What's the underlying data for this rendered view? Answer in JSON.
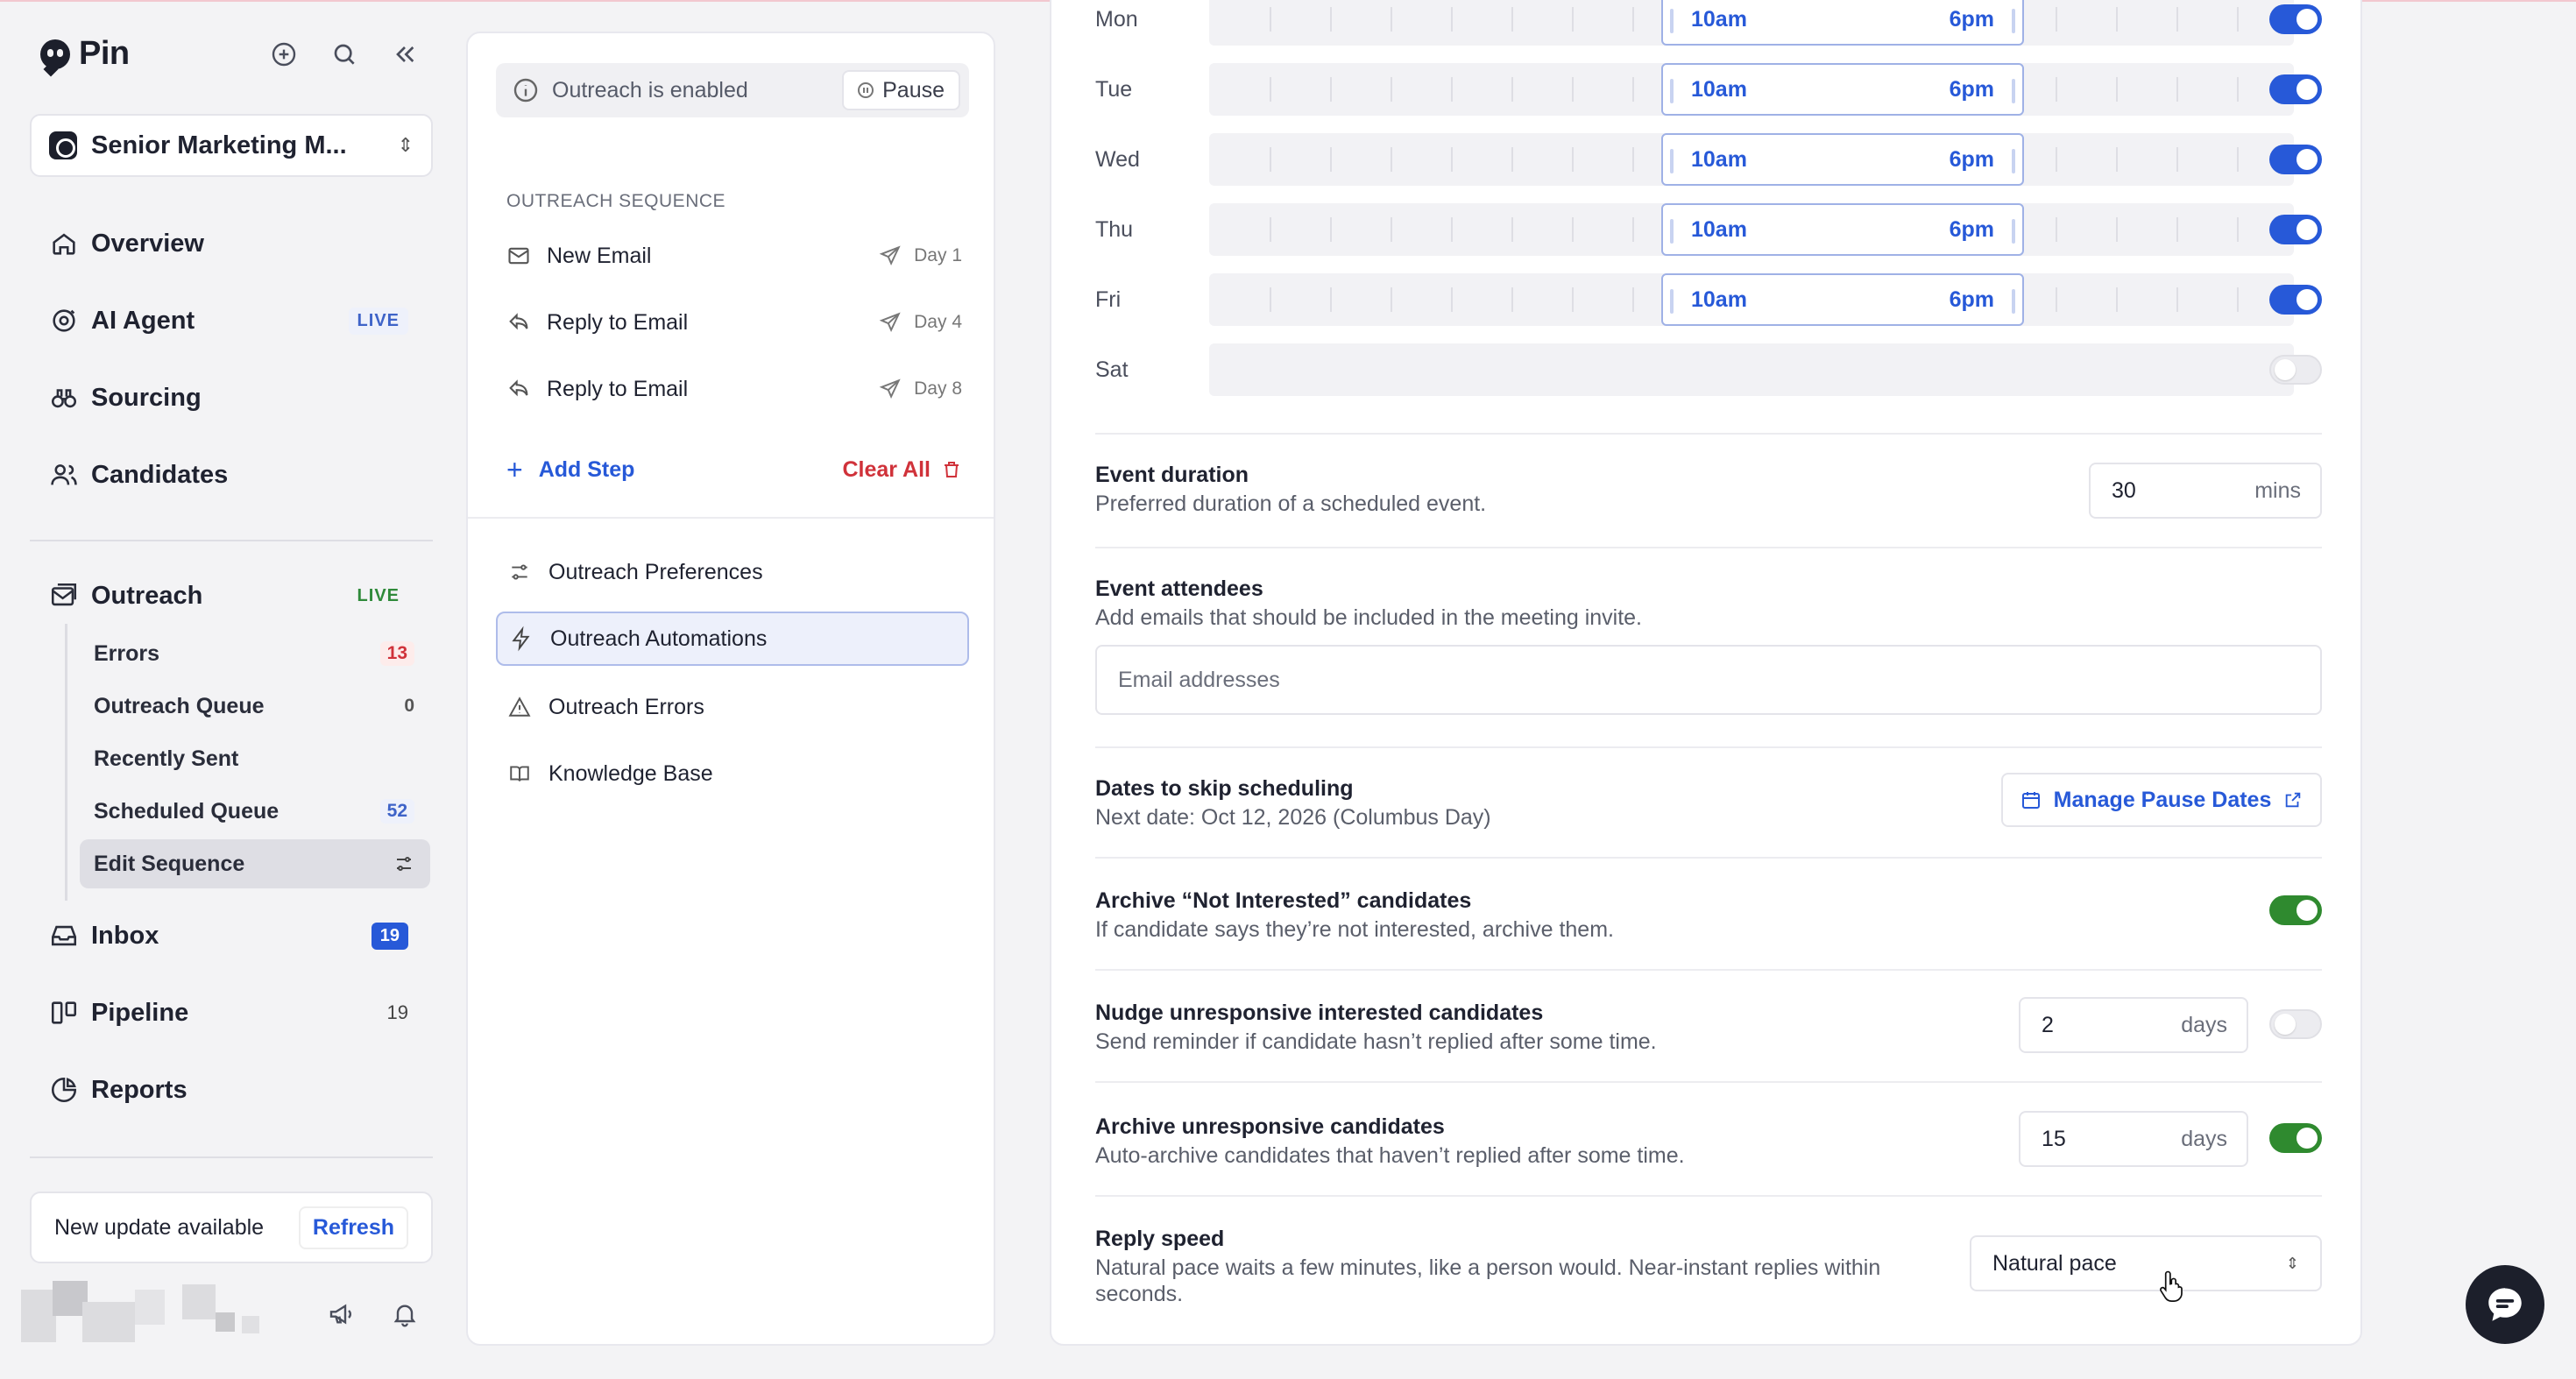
{
  "sidebar": {
    "logo_text": "Pin",
    "workspace_name": "Senior Marketing M...",
    "nav": [
      {
        "label": "Overview",
        "icon": "home-icon"
      },
      {
        "label": "AI Agent",
        "badge": "LIVE",
        "icon": "agent-icon"
      },
      {
        "label": "Sourcing",
        "icon": "binoculars-icon"
      },
      {
        "label": "Candidates",
        "icon": "users-icon"
      }
    ],
    "outreach": {
      "label": "Outreach",
      "badge": "LIVE"
    },
    "outreach_sub": [
      {
        "label": "Errors",
        "count": "13"
      },
      {
        "label": "Outreach Queue",
        "count": "0"
      },
      {
        "label": "Recently Sent",
        "count": ""
      },
      {
        "label": "Scheduled Queue",
        "count": "52"
      },
      {
        "label": "Edit Sequence",
        "count": ""
      }
    ],
    "inbox": {
      "label": "Inbox",
      "count": "19"
    },
    "pipeline": {
      "label": "Pipeline",
      "count": "19"
    },
    "reports": {
      "label": "Reports"
    },
    "update": {
      "text": "New update available",
      "button": "Refresh"
    }
  },
  "middle": {
    "status_text": "Outreach is enabled",
    "pause_label": "Pause",
    "section_heading": "OUTREACH SEQUENCE",
    "steps": [
      {
        "label": "New Email",
        "day": "Day 1"
      },
      {
        "label": "Reply to Email",
        "day": "Day 4"
      },
      {
        "label": "Reply to Email",
        "day": "Day 8"
      }
    ],
    "add_step": "Add Step",
    "clear_all": "Clear All",
    "menu": [
      {
        "label": "Outreach Preferences"
      },
      {
        "label": "Outreach Automations",
        "active": true
      },
      {
        "label": "Outreach Errors"
      },
      {
        "label": "Knowledge Base"
      }
    ]
  },
  "schedule": {
    "days": [
      {
        "name": "Mon",
        "start": "10am",
        "end": "6pm",
        "enabled": true
      },
      {
        "name": "Tue",
        "start": "10am",
        "end": "6pm",
        "enabled": true
      },
      {
        "name": "Wed",
        "start": "10am",
        "end": "6pm",
        "enabled": true
      },
      {
        "name": "Thu",
        "start": "10am",
        "end": "6pm",
        "enabled": true
      },
      {
        "name": "Fri",
        "start": "10am",
        "end": "6pm",
        "enabled": true
      },
      {
        "name": "Sat",
        "enabled": false
      }
    ]
  },
  "settings": {
    "duration": {
      "title": "Event duration",
      "desc": "Preferred duration of a scheduled event.",
      "value": "30",
      "unit": "mins"
    },
    "attendees": {
      "title": "Event attendees",
      "desc": "Add emails that should be included in the meeting invite.",
      "placeholder": "Email addresses"
    },
    "skip": {
      "title": "Dates to skip scheduling",
      "desc": "Next date: Oct 12, 2026 (Columbus Day)",
      "button": "Manage Pause Dates"
    },
    "archive_not_interested": {
      "title": "Archive “Not Interested” candidates",
      "desc": "If candidate says they’re not interested, archive them.",
      "enabled": true
    },
    "nudge": {
      "title": "Nudge unresponsive interested candidates",
      "desc": "Send reminder if candidate hasn’t replied after some time.",
      "value": "2",
      "unit": "days",
      "enabled": false
    },
    "archive_unresponsive": {
      "title": "Archive unresponsive candidates",
      "desc": "Auto-archive candidates that haven’t replied after some time.",
      "value": "15",
      "unit": "days",
      "enabled": true
    },
    "reply_speed": {
      "title": "Reply speed",
      "desc_line1": "Natural pace waits a few minutes, like a person would. Near-instant replies within",
      "desc_line2": "seconds.",
      "value": "Natural pace"
    }
  },
  "colors": {
    "accent": "#2759d8",
    "success": "#2f8a2f",
    "danger": "#d0323a"
  }
}
